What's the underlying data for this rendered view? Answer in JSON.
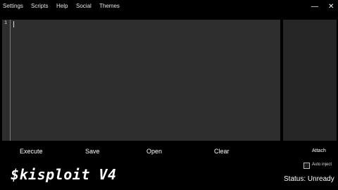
{
  "menu": {
    "settings": "Settings",
    "scripts": "Scripts",
    "help": "Help",
    "social": "Social",
    "themes": "Themes"
  },
  "window": {
    "minimize": "—",
    "close": "✕"
  },
  "editor": {
    "line_number": "1"
  },
  "actions": {
    "execute": "Execute",
    "save": "Save",
    "open": "Open",
    "clear": "Clear",
    "attach": "Attach"
  },
  "logo": "$kisploit  V4",
  "auto_inject": {
    "label": "Auto inject",
    "checked": false
  },
  "status": "Status: Unready",
  "colors": {
    "background": "#000000",
    "editor": "#2e2e2e",
    "side_panel": "#262626"
  }
}
